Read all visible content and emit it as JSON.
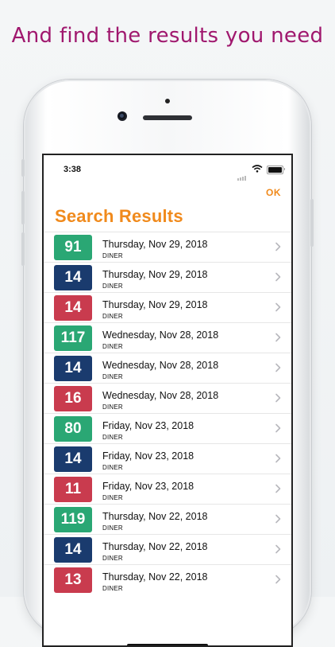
{
  "headline": "And find the results you need",
  "status": {
    "time": "3:38"
  },
  "nav": {
    "ok_label": "OK"
  },
  "page_title": "Search Results",
  "colors": {
    "green": "#2aa774",
    "blue": "#1a3b6e",
    "red": "#c93b4e",
    "accent": "#f08a1c",
    "headline": "#a0186e"
  },
  "results": [
    {
      "score": "91",
      "date": "Thursday, Nov 29, 2018",
      "type": "DINER",
      "color": "#2aa774"
    },
    {
      "score": "14",
      "date": "Thursday, Nov 29, 2018",
      "type": "DINER",
      "color": "#1a3b6e"
    },
    {
      "score": "14",
      "date": "Thursday, Nov 29, 2018",
      "type": "DINER",
      "color": "#c93b4e"
    },
    {
      "score": "117",
      "date": "Wednesday, Nov 28, 2018",
      "type": "DINER",
      "color": "#2aa774"
    },
    {
      "score": "14",
      "date": "Wednesday, Nov 28, 2018",
      "type": "DINER",
      "color": "#1a3b6e"
    },
    {
      "score": "16",
      "date": "Wednesday, Nov 28, 2018",
      "type": "DINER",
      "color": "#c93b4e"
    },
    {
      "score": "80",
      "date": "Friday, Nov 23, 2018",
      "type": "DINER",
      "color": "#2aa774"
    },
    {
      "score": "14",
      "date": "Friday, Nov 23, 2018",
      "type": "DINER",
      "color": "#1a3b6e"
    },
    {
      "score": "11",
      "date": "Friday, Nov 23, 2018",
      "type": "DINER",
      "color": "#c93b4e"
    },
    {
      "score": "119",
      "date": "Thursday, Nov 22, 2018",
      "type": "DINER",
      "color": "#2aa774"
    },
    {
      "score": "14",
      "date": "Thursday, Nov 22, 2018",
      "type": "DINER",
      "color": "#1a3b6e"
    },
    {
      "score": "13",
      "date": "Thursday, Nov 22, 2018",
      "type": "DINER",
      "color": "#c93b4e"
    }
  ]
}
